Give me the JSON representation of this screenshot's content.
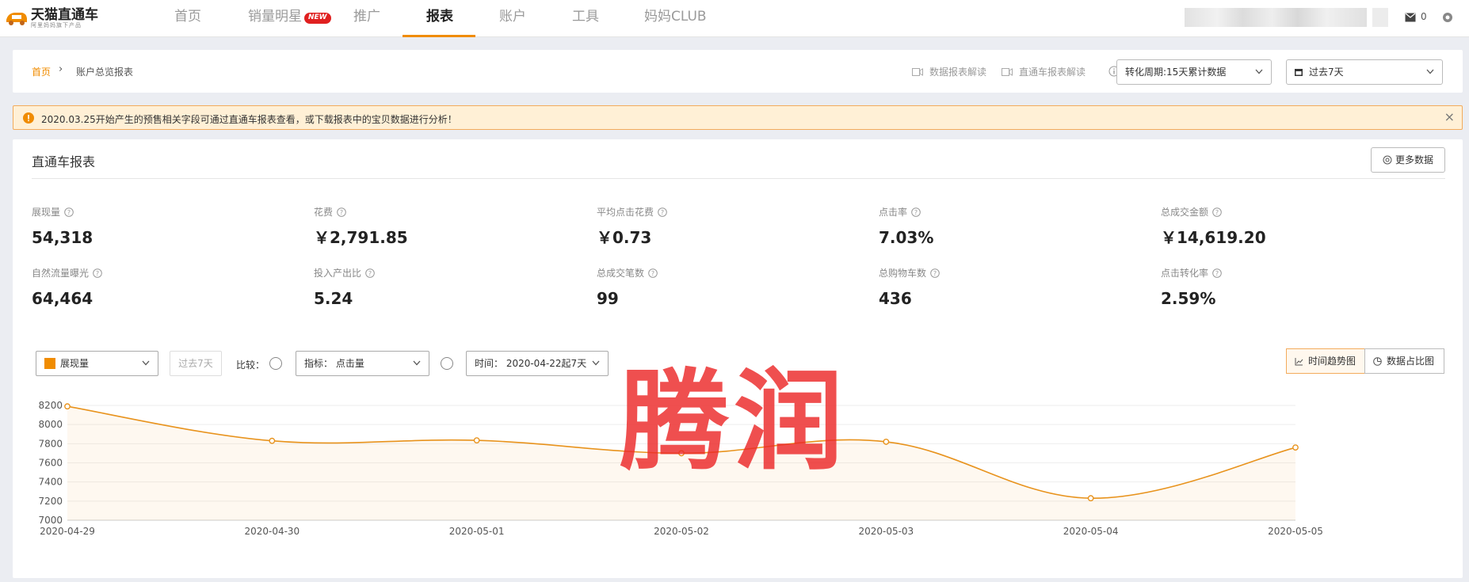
{
  "brand": {
    "title": "天猫直通车",
    "subtitle": "阿里妈妈旗下产品"
  },
  "nav": {
    "items": [
      {
        "label": "首页"
      },
      {
        "label": "销量明星",
        "badge": "NEW"
      },
      {
        "label": "推广"
      },
      {
        "label": "报表",
        "active": true
      },
      {
        "label": "账户"
      },
      {
        "label": "工具"
      },
      {
        "label": "妈妈CLUB"
      }
    ],
    "mail_count": "0"
  },
  "breadcrumb": {
    "home": "首页",
    "separator": "›",
    "current": "账户总览报表"
  },
  "toolbar": {
    "video_link_1": "数据报表解读",
    "video_link_2": "直通车报表解读",
    "conversion_period": "转化周期:15天累计数据",
    "date_range": "过去7天"
  },
  "notice": {
    "text": "2020.03.25开始产生的预售相关字段可通过直通车报表查看，或下载报表中的宝贝数据进行分析！",
    "close": "×"
  },
  "report": {
    "title": "直通车报表",
    "more_button": "更多数据",
    "metrics": [
      {
        "label": "展现量",
        "value": "54,318"
      },
      {
        "label": "花费",
        "value": "￥2,791.85"
      },
      {
        "label": "平均点击花费",
        "value": "￥0.73"
      },
      {
        "label": "点击率",
        "value": "7.03%"
      },
      {
        "label": "总成交金额",
        "value": "￥14,619.20"
      },
      {
        "label": "自然流量曝光",
        "value": "64,464"
      },
      {
        "label": "投入产出比",
        "value": "5.24"
      },
      {
        "label": "总成交笔数",
        "value": "99"
      },
      {
        "label": "总购物车数",
        "value": "436"
      },
      {
        "label": "点击转化率",
        "value": "2.59%"
      }
    ]
  },
  "chart_controls": {
    "metric_select": "展现量",
    "period_button": "过去7天",
    "compare_label": "比较：",
    "indicator_select": "指标： 点击量",
    "time_select": "时间： 2020-04-22起7天",
    "view_trend": "时间趋势图",
    "view_share": "数据占比图"
  },
  "colors": {
    "accent": "#f08c00",
    "line": "#e8931d",
    "watermark": "#eb2828"
  },
  "watermark": "腾润",
  "chart_data": {
    "type": "line",
    "categories": [
      "2020-04-29",
      "2020-04-30",
      "2020-05-01",
      "2020-05-02",
      "2020-05-03",
      "2020-05-04",
      "2020-05-05"
    ],
    "series": [
      {
        "name": "展现量",
        "values": [
          8190,
          7830,
          7835,
          7700,
          7820,
          7230,
          7760
        ]
      }
    ],
    "y_ticks": [
      "8200",
      "8000",
      "7800",
      "7600",
      "7400",
      "7200",
      "7000"
    ],
    "ylim": [
      7000,
      8200
    ],
    "area_fill": true,
    "grid": true
  }
}
